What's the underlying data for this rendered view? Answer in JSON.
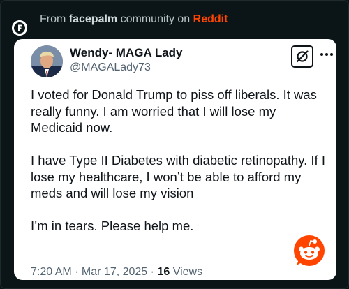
{
  "header": {
    "prefix": "From",
    "community": "facepalm",
    "middle": "community on",
    "platform": "Reddit"
  },
  "colors": {
    "background": "#0b1416",
    "reddit_orange": "#ff4500",
    "card": "#ffffff"
  },
  "tweet": {
    "display_name": "Wendy- MAGA Lady",
    "handle": "@MAGALady73",
    "paragraphs": [
      "I voted for Donald Trump to piss off liberals. It was really funny. I am worried that I will lose my Medicaid now.",
      "I have Type II Diabetes with diabetic retinopathy. If I lose my healthcare, I won’t be able to afford my meds and will lose my vision",
      "I’m in tears. Please help me."
    ],
    "time": "7:20 AM · Mar 17, 2025 ·",
    "views_count": "16",
    "views_label": "Views"
  },
  "icons": {
    "community": "community-f-icon",
    "grok": "grok-icon",
    "more": "more-horizontal-icon",
    "watermark": "reddit-snoo-icon"
  }
}
